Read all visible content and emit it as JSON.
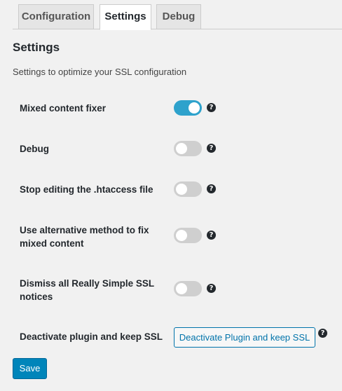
{
  "tabs": [
    {
      "label": "Configuration",
      "active": false
    },
    {
      "label": "Settings",
      "active": true
    },
    {
      "label": "Debug",
      "active": false
    }
  ],
  "section": {
    "title": "Settings",
    "description": "Settings to optimize your SSL configuration"
  },
  "settings": [
    {
      "label": "Mixed content fixer",
      "enabled": true
    },
    {
      "label": "Debug",
      "enabled": false
    },
    {
      "label": "Stop editing the .htaccess file",
      "enabled": false
    },
    {
      "label": "Use alternative method to fix mixed content",
      "enabled": false
    },
    {
      "label": "Dismiss all Really Simple SSL notices",
      "enabled": false
    }
  ],
  "deactivate": {
    "label": "Deactivate plugin and keep SSL",
    "button_label": "Deactivate Plugin and keep SSL"
  },
  "help_glyph": "?",
  "save_label": "Save",
  "colors": {
    "toggle_on": "#2ea2cc",
    "toggle_off": "#cfcfcf",
    "primary_button": "#0085ba",
    "link_blue": "#0073aa"
  }
}
